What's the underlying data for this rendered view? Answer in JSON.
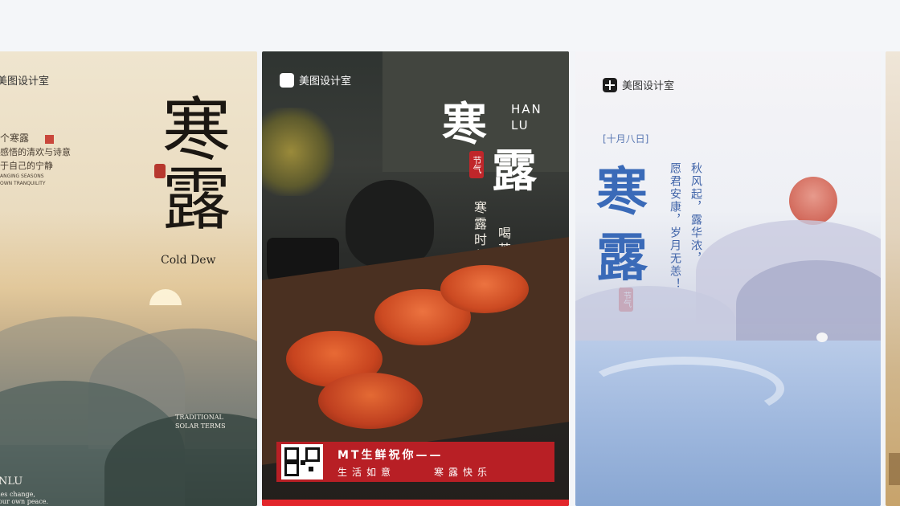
{
  "cards": [
    {
      "brand": "美图设计室",
      "title_chars": "寒露",
      "subtitle_en": "Cold Dew",
      "lines": [
        "个寒露",
        "感悟的清欢与诗意",
        "于自己的宁静",
        "ANGING SEASONS",
        "OWN TRANQUILITY"
      ],
      "traditional": [
        "TRADITIONAL",
        "SOLAR TERMS"
      ],
      "bottom": [
        "NLU",
        "ies change,",
        "our own peace."
      ]
    },
    {
      "brand": "美图设计室",
      "char1": "寒",
      "char2": "露",
      "pinyin1": "HAN",
      "pinyin2": "LU",
      "seal": "节气",
      "vertical1": "寒露时节",
      "vertical2": "喝茶吃蟹",
      "banner_title": "MT生鲜祝你——",
      "banner_sub1": "生活如意",
      "banner_sub2": "寒露快乐"
    },
    {
      "brand": "美图设计室",
      "date": "[十月八日]",
      "char1": "寒",
      "char2": "露",
      "seal": "节气",
      "poem1": "秋风起，露华浓，",
      "poem2": "愿君安康，岁月无恙！"
    }
  ]
}
